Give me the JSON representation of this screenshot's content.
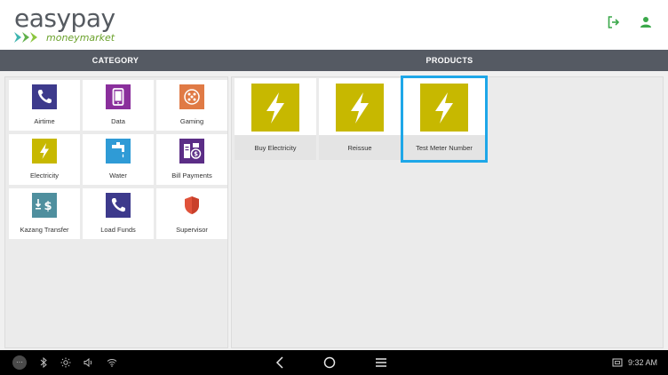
{
  "header": {
    "logo_main_easy": "easy",
    "logo_main_pay": "pay",
    "logo_sub": "moneymarket",
    "actions": [
      {
        "icon": "logout-icon"
      },
      {
        "icon": "user-icon"
      }
    ]
  },
  "sections": {
    "category_label": "CATEGORY",
    "products_label": "PRODUCTS"
  },
  "categories": [
    {
      "label": "Airtime",
      "icon": "phone-icon",
      "bg": "#3d3a8c"
    },
    {
      "label": "Data",
      "icon": "tablet-icon",
      "bg": "#8a2f9c"
    },
    {
      "label": "Gaming",
      "icon": "gaming-icon",
      "bg": "#e07a45"
    },
    {
      "label": "Electricity",
      "icon": "lightning-icon",
      "bg": "#c7b800"
    },
    {
      "label": "Water",
      "icon": "water-tap-icon",
      "bg": "#2f9bd6"
    },
    {
      "label": "Bill Payments",
      "icon": "bill-payments-icon",
      "bg": "#5b2d86"
    },
    {
      "label": "Kazang Transfer",
      "icon": "transfer-icon",
      "bg": "#4f8f9e"
    },
    {
      "label": "Load Funds",
      "icon": "phone-icon",
      "bg": "#3d3a8c"
    },
    {
      "label": "Supervisor",
      "icon": "shield-icon",
      "bg": "#e0523a"
    }
  ],
  "products": [
    {
      "label": "Buy Electricity",
      "icon": "lightning-icon",
      "bg": "#c7b800",
      "selected": false
    },
    {
      "label": "Reissue",
      "icon": "lightning-icon",
      "bg": "#c7b800",
      "selected": false
    },
    {
      "label": "Test Meter Number",
      "icon": "lightning-icon",
      "bg": "#c7b800",
      "selected": true
    }
  ],
  "colors": {
    "section_bar": "#555a63",
    "accent_selected": "#1ea7e8",
    "brand_green": "#6aa12a"
  },
  "system_bar": {
    "left_icons": [
      "more-icon",
      "bluetooth-icon",
      "brightness-icon",
      "volume-icon",
      "wifi-icon"
    ],
    "nav_icons": [
      "back-icon",
      "home-icon",
      "menu-icon"
    ],
    "time": "9:32 AM",
    "screenshot_icon": "screen-icon"
  }
}
